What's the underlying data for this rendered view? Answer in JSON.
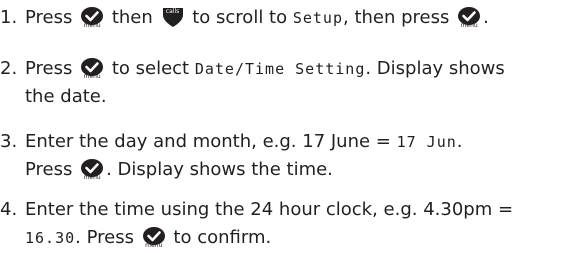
{
  "key_labels": {
    "menu": "menu",
    "calls": "calls"
  },
  "icons": {
    "menu_key": "menu-key-icon",
    "calls_key": "calls-down-key-icon"
  },
  "colors": {
    "text": "#231f20",
    "key_fill": "#231f20",
    "background": "#ffffff"
  },
  "steps": [
    {
      "number": "1.",
      "t1": "Press ",
      "t2": " then ",
      "t3": " to scroll to ",
      "lcd1": "Setup",
      "t4": ", then press ",
      "t5": "."
    },
    {
      "number": "2.",
      "t1": "Press ",
      "t2": " to select ",
      "lcd1": "Date/Time Setting",
      "t3": ". Display shows",
      "t4": "the date."
    },
    {
      "number": "3.",
      "t1": "Enter the day and month, e.g. 17 June = ",
      "lcd1": "17 Jun",
      "t2": ".",
      "t3": "Press ",
      "t4": ". Display shows the time."
    },
    {
      "number": "4.",
      "t1": "Enter the time using the 24 hour clock, e.g. 4.30pm =",
      "lcd1": "16.30",
      "t2": ". Press ",
      "t3": " to confirm."
    }
  ]
}
